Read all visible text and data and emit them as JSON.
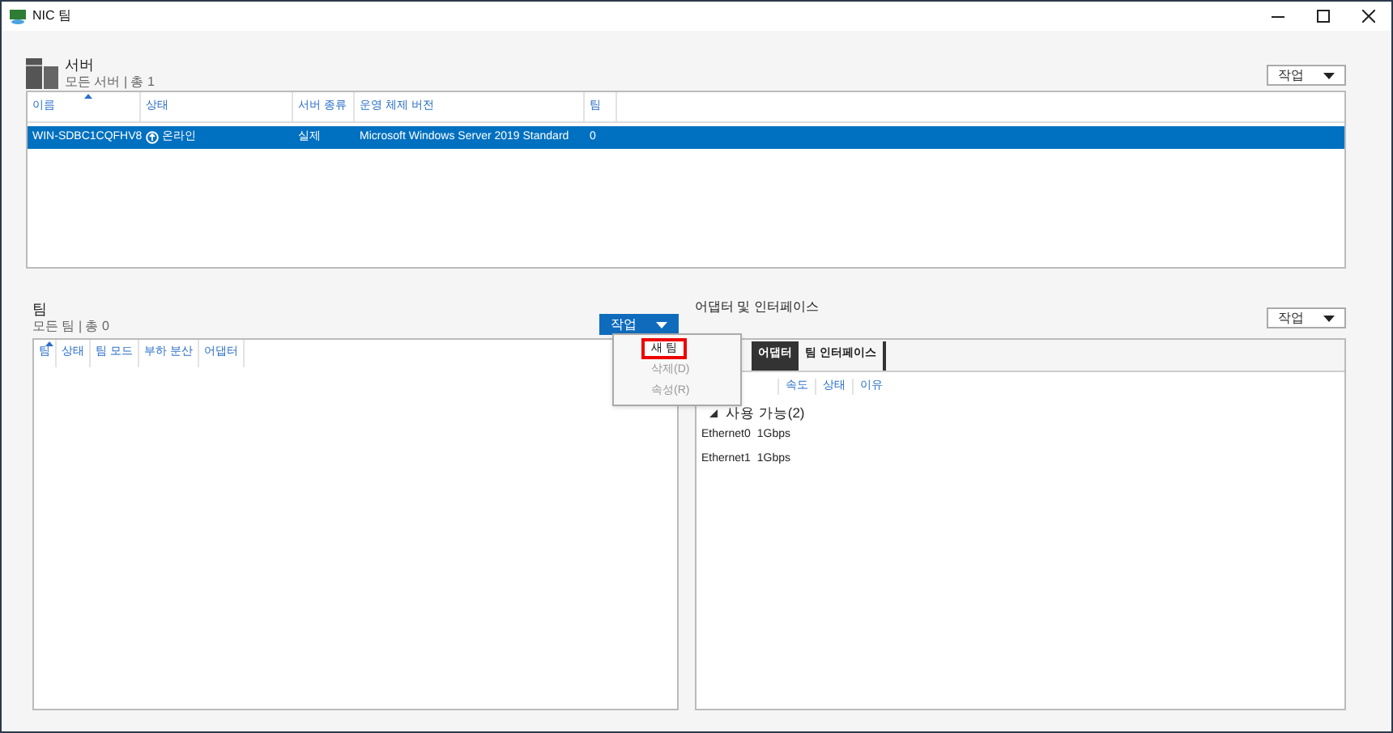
{
  "window": {
    "title": "NIC 팀"
  },
  "servers": {
    "title": "서버",
    "subtitle": "모든 서버 | 총 1",
    "action": {
      "label": "작업",
      "open": false
    },
    "columns": [
      {
        "label": "이름",
        "sorted": true
      },
      {
        "label": "상태",
        "sorted": false
      },
      {
        "label": "서버 종류",
        "sorted": false
      },
      {
        "label": "운영 체제 버전",
        "sorted": false
      },
      {
        "label": "팀",
        "sorted": false
      }
    ],
    "rows": [
      {
        "selected": true,
        "cells": [
          "WIN-SDBC1CQFHV8",
          "온라인",
          "실제",
          "Microsoft Windows Server 2019 Standard",
          "0"
        ]
      }
    ]
  },
  "teams": {
    "title": "팀",
    "subtitle": "모든 팀 | 총 0",
    "action": {
      "label": "작업",
      "open": true
    },
    "menu": [
      {
        "label": "새 팀",
        "disabled": false,
        "highlighted": true
      },
      {
        "label": "삭제(D)",
        "disabled": true,
        "highlighted": false
      },
      {
        "label": "속성(R)",
        "disabled": true,
        "highlighted": false
      }
    ],
    "columns": [
      {
        "label": "팀",
        "sorted": true
      },
      {
        "label": "상태",
        "sorted": false
      },
      {
        "label": "팀 모드",
        "sorted": false
      },
      {
        "label": "부하 분산",
        "sorted": false
      },
      {
        "label": "어댑터",
        "sorted": false
      }
    ]
  },
  "adapters": {
    "title": "어댑터 및 인터페이스",
    "action": {
      "label": "작업",
      "open": false
    },
    "tabs": [
      {
        "label": "어댑터",
        "selected": true
      },
      {
        "label": "팀 인터페이스",
        "selected": false
      }
    ],
    "columns": [
      "속도",
      "상태",
      "이유"
    ],
    "groups": [
      {
        "label": "사용 가능(2)",
        "expanded": true,
        "rows": [
          [
            "Ethernet0",
            "1Gbps"
          ],
          [
            "Ethernet1",
            "1Gbps"
          ]
        ]
      }
    ]
  }
}
